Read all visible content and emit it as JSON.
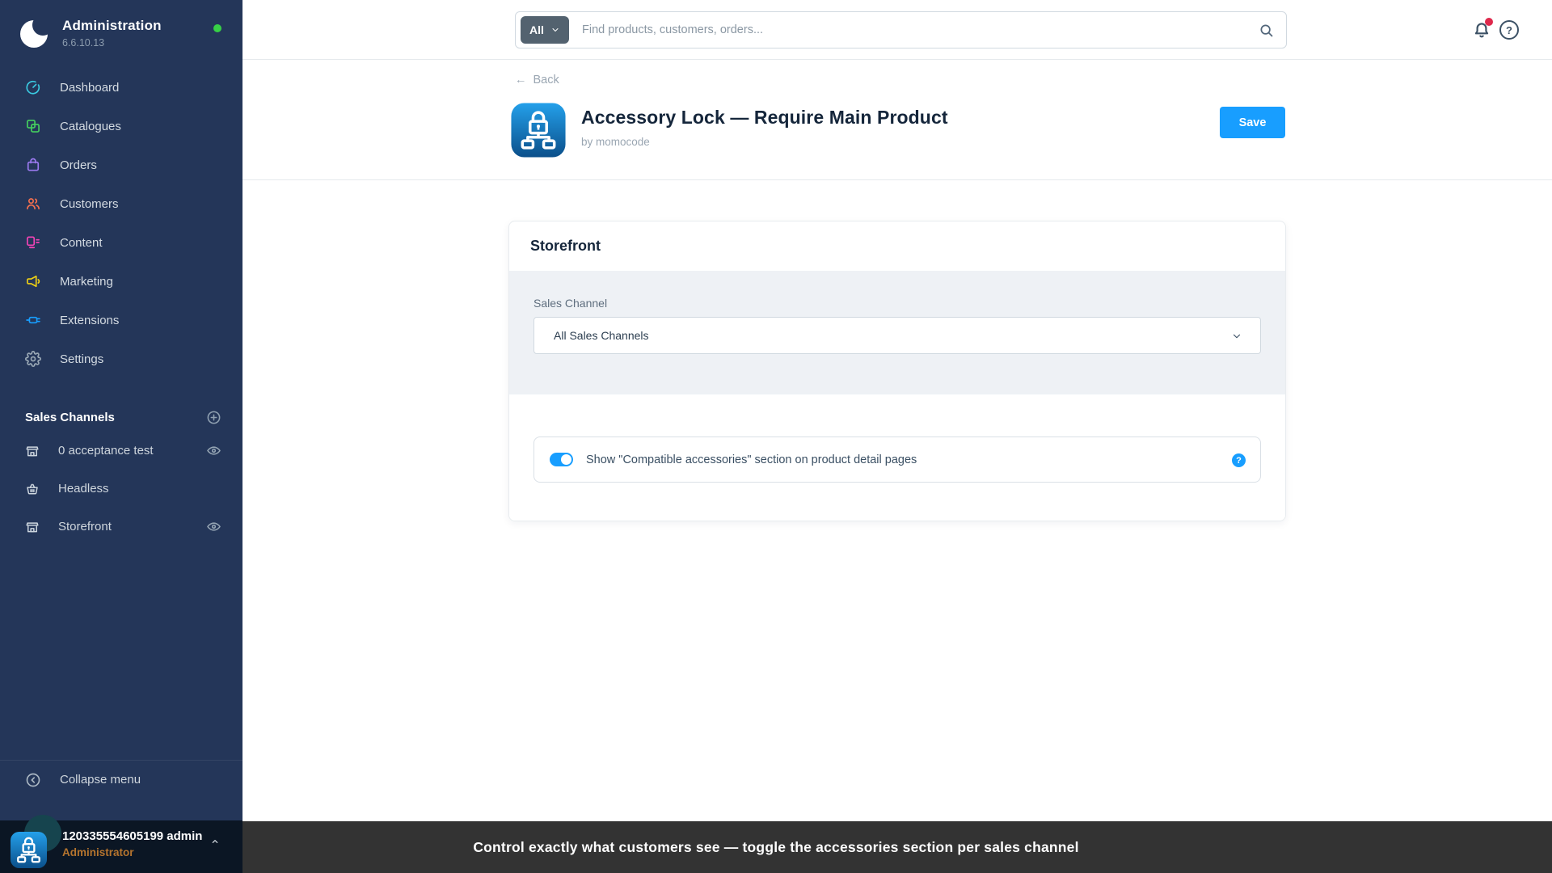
{
  "sidebar": {
    "brand": {
      "title": "Administration",
      "version": "6.6.10.13"
    },
    "nav": [
      {
        "label": "Dashboard",
        "icon": "gauge-icon",
        "color": "#3ac9e0"
      },
      {
        "label": "Catalogues",
        "icon": "catalogues-icon",
        "color": "#45d15f"
      },
      {
        "label": "Orders",
        "icon": "shopping-bag-icon",
        "color": "#9b7af0"
      },
      {
        "label": "Customers",
        "icon": "users-icon",
        "color": "#f4704f"
      },
      {
        "label": "Content",
        "icon": "layout-icon",
        "color": "#f443b6"
      },
      {
        "label": "Marketing",
        "icon": "megaphone-icon",
        "color": "#f0d114"
      },
      {
        "label": "Extensions",
        "icon": "plug-icon",
        "color": "#189eff"
      },
      {
        "label": "Settings",
        "icon": "gear-icon",
        "color": "#9aa8b5"
      }
    ],
    "sales_channels": {
      "header": "Sales Channels",
      "items": [
        {
          "label": "0 acceptance test",
          "icon": "storefront-icon",
          "has_eye": true
        },
        {
          "label": "Headless",
          "icon": "basket-icon",
          "has_eye": false
        },
        {
          "label": "Storefront",
          "icon": "storefront-icon",
          "has_eye": true
        }
      ]
    },
    "collapse_label": "Collapse menu",
    "user": {
      "name": "120335554605199 admin ...",
      "role": "Administrator"
    }
  },
  "topbar": {
    "scope_label": "All",
    "search_placeholder": "Find products, customers, orders...",
    "has_notification": true
  },
  "page_header": {
    "back_label": "Back",
    "title": "Accessory Lock — Require Main Product",
    "byline": "by momocode",
    "save_label": "Save"
  },
  "card": {
    "title": "Storefront",
    "sales_channel_label": "Sales Channel",
    "sales_channel_value": "All Sales Channels",
    "toggle": {
      "label": "Show \"Compatible accessories\" section on product detail pages",
      "state": "on"
    }
  },
  "footer_toast": {
    "message": "Control exactly what customers see — toggle the accessories section per sales channel"
  },
  "colors": {
    "accent": "#189eff",
    "sidebar_bg": "#243659",
    "toast_bg": "#333333",
    "status_green": "#37d046",
    "notification_red": "#de294c",
    "role_amber": "#b5742e"
  }
}
